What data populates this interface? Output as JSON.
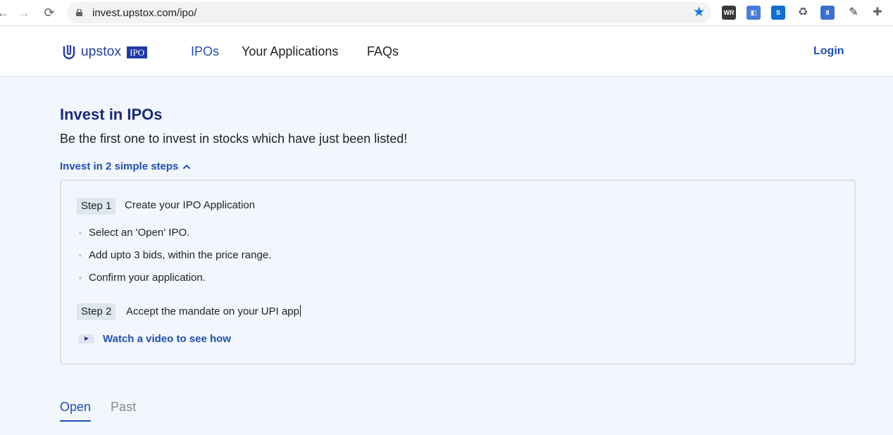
{
  "browser": {
    "url": "invest.upstox.com/ipo/",
    "back_icon": "back-arrow-icon",
    "forward_icon": "forward-arrow-icon",
    "reload_icon": "reload-icon",
    "extensions": [
      {
        "label": "WR",
        "color": "#3a3a3a"
      },
      {
        "label": "◧",
        "color": "#4a7cd8"
      },
      {
        "label": "S",
        "color": "#0f6fd1"
      },
      {
        "label": "♻",
        "color": "#5a5a5a"
      },
      {
        "label": "8",
        "color": "#3b6fcf"
      },
      {
        "label": "✎",
        "color": "#333333"
      },
      {
        "label": "✚",
        "color": "#5f6368"
      }
    ]
  },
  "header": {
    "logo_text": "upstox",
    "logo_badge": "IPO",
    "nav": [
      "IPOs",
      "Your Applications",
      "FAQs"
    ],
    "login": "Login"
  },
  "main": {
    "title": "Invest in IPOs",
    "subtitle": "Be the first one to invest in stocks which have just been listed!",
    "steps_toggle": "Invest in 2 simple steps",
    "step1": {
      "tag": "Step 1",
      "text": "Create your IPO Application",
      "bullets": [
        "Select an 'Open' IPO.",
        "Add upto 3 bids, within the price range.",
        "Confirm your application."
      ]
    },
    "step2": {
      "tag": "Step 2",
      "text": "Accept the mandate on your UPI app"
    },
    "video_link": "Watch a video to see how"
  },
  "tabs": {
    "open": "Open",
    "past": "Past"
  },
  "colors": {
    "brand": "#1f3aa8",
    "link": "#1f4fb8",
    "page_bg": "#f2f7fd"
  }
}
